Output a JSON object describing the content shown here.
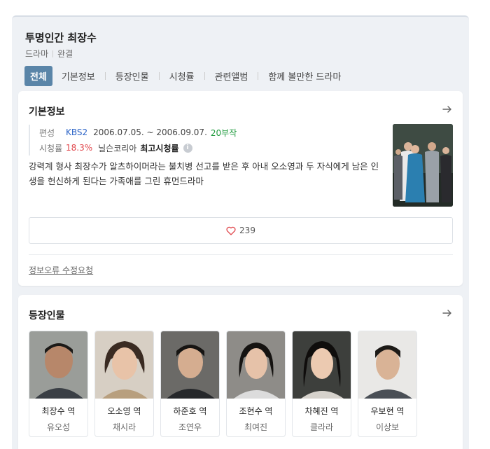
{
  "header": {
    "title": "투명인간 최장수",
    "genre": "드라마",
    "status": "완결"
  },
  "tabs": [
    {
      "label": "전체",
      "active": true
    },
    {
      "label": "기본정보"
    },
    {
      "label": "등장인물"
    },
    {
      "label": "시청률"
    },
    {
      "label": "관련앨범"
    },
    {
      "label": "함께 볼만한 드라마"
    }
  ],
  "basic_info": {
    "section_title": "기본정보",
    "broadcast_label": "편성",
    "channel": "KBS2",
    "period": "2006.07.05. ~ 2006.09.07.",
    "episodes": "20부작",
    "rating_label": "시청률",
    "rating_value": "18.3%",
    "rating_source": "닐슨코리아",
    "rating_note": "최고시청률",
    "description": "강력계 형사 최장수가 알츠하이머라는 불치병 선고를 받은 후 아내 오소영과 두 자식에게 남은 인생을 헌신하게 된다는 가족애를 그린 휴먼드라마",
    "likes": "239",
    "report_link": "정보오류 수정요청"
  },
  "cast": {
    "section_title": "등장인물",
    "members": [
      {
        "role": "최장수 역",
        "actor": "유오성"
      },
      {
        "role": "오소영 역",
        "actor": "채시라"
      },
      {
        "role": "하준호 역",
        "actor": "조연우"
      },
      {
        "role": "조현수 역",
        "actor": "최여진"
      },
      {
        "role": "차혜진 역",
        "actor": "클라라"
      },
      {
        "role": "우보현 역",
        "actor": "이상보"
      }
    ]
  },
  "colors": {
    "accent": "#5a85a8",
    "channel": "#2c64c7",
    "episodes": "#1e9a3c",
    "rating": "#e0474c"
  }
}
